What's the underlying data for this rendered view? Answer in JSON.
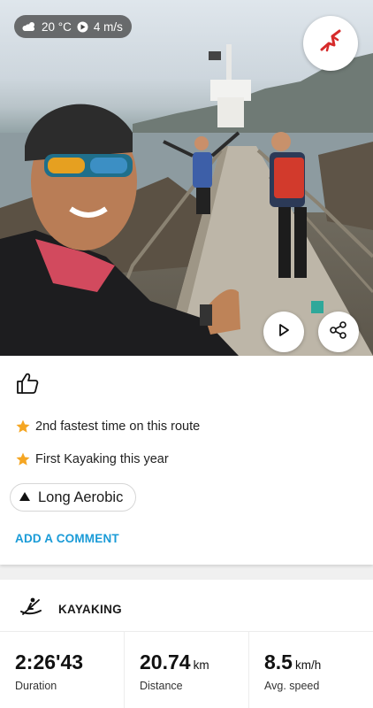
{
  "header": {
    "weather": {
      "icon": "cloud-sun-icon",
      "temperature": "20 °C",
      "wind_icon": "wind-direction-icon",
      "wind": "4 m/s"
    },
    "map_button_icon": "route-map-icon",
    "play_button_icon": "play-icon",
    "share_button_icon": "share-icon"
  },
  "feed_card": {
    "like_icon": "thumbs-up-icon",
    "achievements": [
      {
        "icon": "star-icon",
        "text": "2nd fastest time on this route"
      },
      {
        "icon": "star-icon",
        "text": "First Kayaking this year"
      }
    ],
    "training_effect": {
      "icon": "triangle-up-icon",
      "label": "Long Aerobic"
    },
    "add_comment": "ADD A COMMENT"
  },
  "summary": {
    "sport_icon": "kayaking-icon",
    "sport": "KAYAKING",
    "stats": [
      {
        "value": "2:26'43",
        "unit": "",
        "label": "Duration"
      },
      {
        "value": "20.74",
        "unit": "km",
        "label": "Distance"
      },
      {
        "value": "8.5",
        "unit": "km/h",
        "label": "Avg. speed"
      }
    ]
  },
  "colors": {
    "accent": "#1a9bd7",
    "star": "#f5a623",
    "route": "#d62b2b"
  }
}
